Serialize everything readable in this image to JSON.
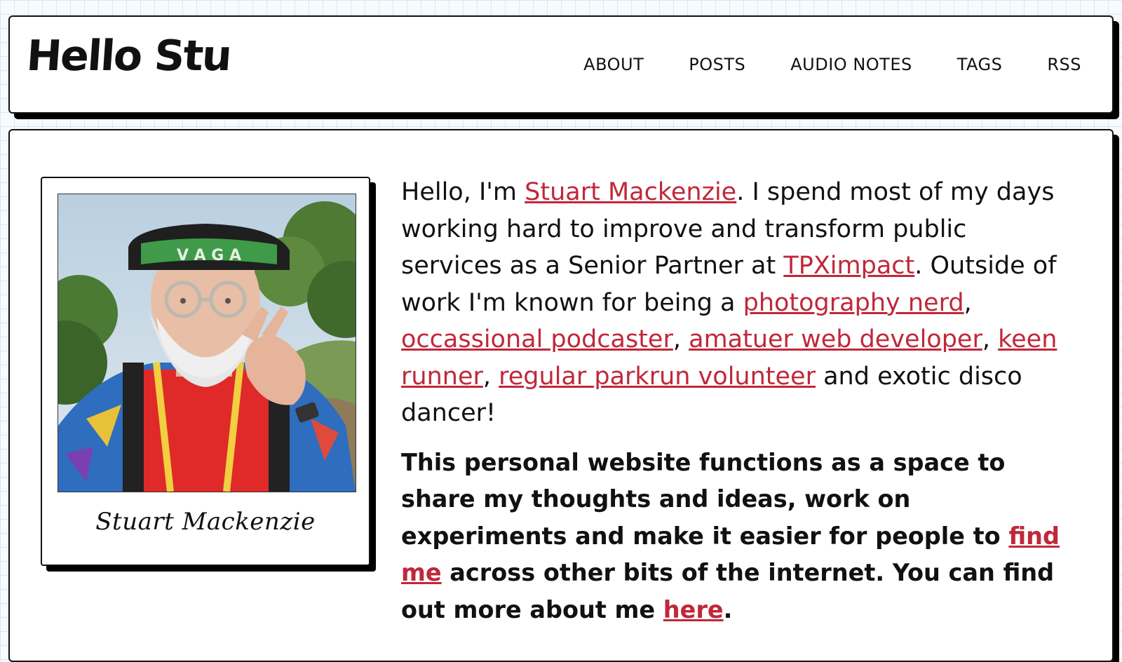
{
  "header": {
    "logo": "Hello Stu",
    "nav": [
      "ABOUT",
      "POSTS",
      "AUDIO NOTES",
      "TAGS",
      "RSS"
    ]
  },
  "profile": {
    "caption": "Stuart Mackenzie",
    "cap_text": "V A G A"
  },
  "bio": {
    "p1": {
      "t1": "Hello, I'm ",
      "link_name": "Stuart Mackenzie",
      "t2": ". I spend most of my days working hard to improve and transform public services as a Senior Partner at ",
      "link_company": "TPXimpact",
      "t3": ". Outside of work I'm known for being a ",
      "link_photo": "photography nerd",
      "s1": ", ",
      "link_podcast": "occassional podcaster",
      "s2": ", ",
      "link_webdev": "amatuer web developer",
      "s3": ", ",
      "link_runner": "keen runner",
      "s4": ", ",
      "link_parkrun": "regular parkrun volunteer",
      "t4": " and exotic disco dancer!"
    },
    "p2": {
      "t1": "This personal website functions as a space to share my thoughts and ideas, work on experiments and make it easier for people to ",
      "link_find": "find me",
      "t2": " across other bits of the internet. You can find out more about me ",
      "link_here": "here",
      "t3": "."
    }
  },
  "colors": {
    "link": "#c0283a",
    "grid": "#d6e9f2",
    "border": "#111111"
  }
}
